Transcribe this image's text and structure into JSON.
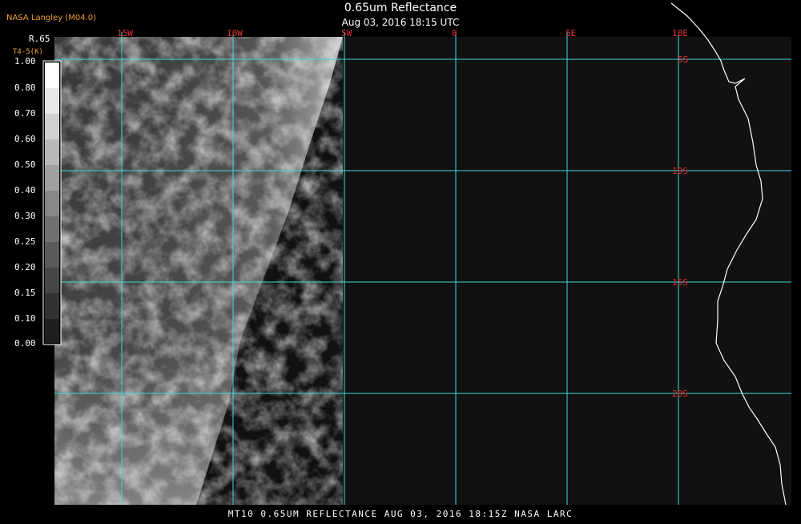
{
  "header": {
    "title": "0.65um Reflectance",
    "subtitle": "Aug 03, 2016 18:15 UTC",
    "provider": "NASA Langley (M04.0)"
  },
  "footer": {
    "caption": "MT10   0.65UM REFLECTANCE   AUG 03, 2016 18:15Z   NASA LARC"
  },
  "legend": {
    "title": "R.65",
    "subtitle": "T4-5(K)",
    "labels": [
      "1.00",
      "0.80",
      "0.70",
      "0.60",
      "0.50",
      "0.40",
      "0.30",
      "0.25",
      "0.20",
      "0.15",
      "0.10",
      "0.00"
    ]
  },
  "grid": {
    "longitude_labels": [
      "15W",
      "10W",
      "5W",
      "0",
      "5E",
      "10E"
    ],
    "latitude_labels": [
      "5S",
      "10S",
      "15S",
      "20S"
    ]
  },
  "colors": {
    "grid_line": "#40d8e0",
    "grid_label": "#e03030",
    "coastline": "#ffffff",
    "provider_text": "#f0a030",
    "background": "#000000",
    "scan_area": "#111111"
  }
}
